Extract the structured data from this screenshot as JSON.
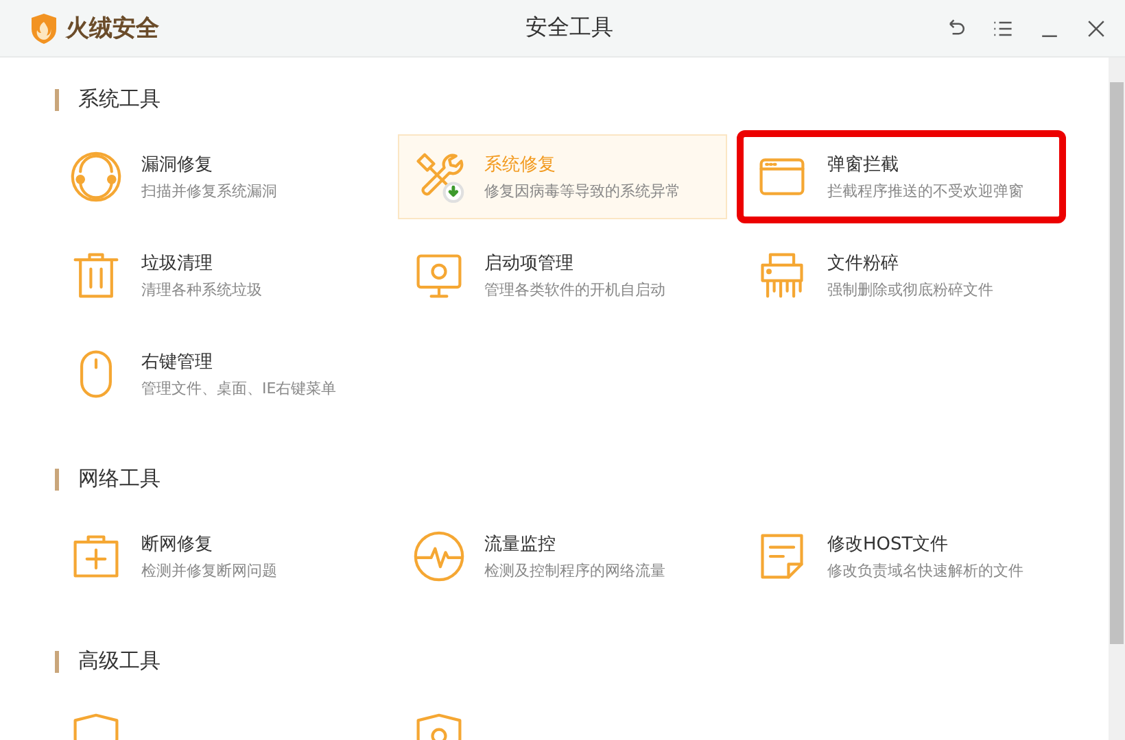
{
  "window": {
    "brand": "火绒安全",
    "title": "安全工具"
  },
  "sections": [
    {
      "title": "系统工具",
      "items": [
        {
          "name": "漏洞修复",
          "desc": "扫描并修复系统漏洞",
          "hovered": false,
          "marked": false
        },
        {
          "name": "系统修复",
          "desc": "修复因病毒等导致的系统异常",
          "hovered": true,
          "marked": false
        },
        {
          "name": "弹窗拦截",
          "desc": "拦截程序推送的不受欢迎弹窗",
          "hovered": false,
          "marked": true
        },
        {
          "name": "垃圾清理",
          "desc": "清理各种系统垃圾",
          "hovered": false,
          "marked": false
        },
        {
          "name": "启动项管理",
          "desc": "管理各类软件的开机自启动",
          "hovered": false,
          "marked": false
        },
        {
          "name": "文件粉碎",
          "desc": "强制删除或彻底粉碎文件",
          "hovered": false,
          "marked": false
        },
        {
          "name": "右键管理",
          "desc": "管理文件、桌面、IE右键菜单",
          "hovered": false,
          "marked": false
        }
      ]
    },
    {
      "title": "网络工具",
      "items": [
        {
          "name": "断网修复",
          "desc": "检测并修复断网问题",
          "hovered": false,
          "marked": false
        },
        {
          "name": "流量监控",
          "desc": "检测及控制程序的网络流量",
          "hovered": false,
          "marked": false
        },
        {
          "name": "修改HOST文件",
          "desc": "修改负责域名快速解析的文件",
          "hovered": false,
          "marked": false
        }
      ]
    },
    {
      "title": "高级工具",
      "items": [
        {
          "hovered": false,
          "marked": false
        },
        {
          "hovered": false,
          "marked": false
        }
      ]
    }
  ]
}
